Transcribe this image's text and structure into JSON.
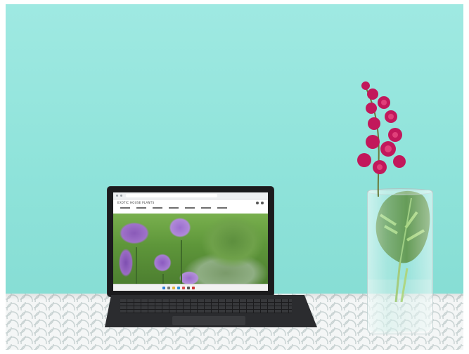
{
  "scene": {
    "wall_color": "#97e6de",
    "table_color": "#f4f6f6",
    "flower_color": "#c2185b",
    "leaf_color": "#4b8b3b"
  },
  "laptop_screen": {
    "site_title": "EXOTIC HOUSE PLANTS",
    "nav_items": [
      "",
      "",
      "",
      "",
      "",
      "",
      "",
      ""
    ]
  }
}
